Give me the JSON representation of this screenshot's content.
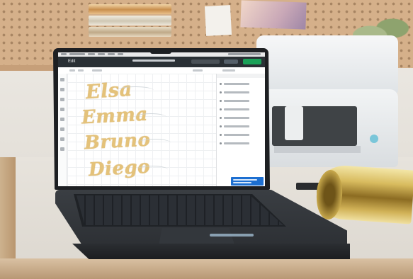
{
  "photo": {
    "subject": "laptop-with-cutting-machine"
  },
  "app": {
    "brand": "Edit"
  },
  "canvas": {
    "names": [
      "Elsa",
      "Emma",
      "Bruno",
      "Diego"
    ]
  },
  "colors": {
    "name_fill": "#e4c27a",
    "make_button": "#1aa158",
    "topbar": "#2a3035",
    "promo": "#1d6fd1"
  }
}
